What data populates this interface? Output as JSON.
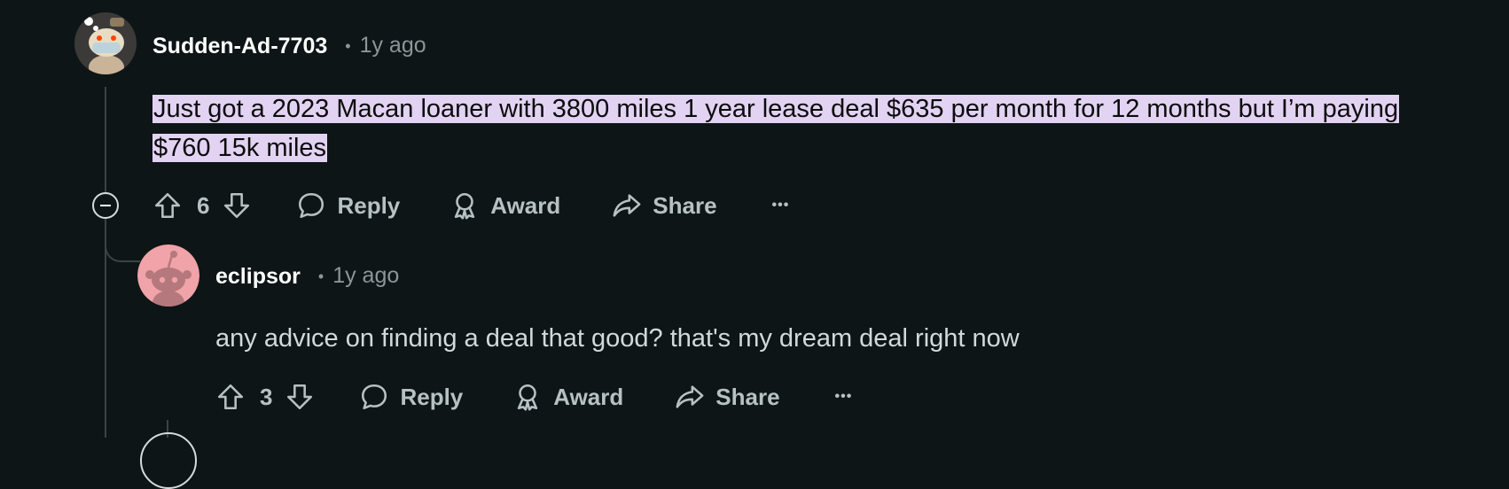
{
  "comments": [
    {
      "username": "Sudden-Ad-7703",
      "time": "1y ago",
      "body": "Just got a 2023 Macan loaner with 3800 miles 1 year lease deal $635 per month for 12 months but I’m paying $760 15k miles",
      "votes": "6",
      "avatar_icon": "snoo-mask-avatar-icon"
    },
    {
      "username": "eclipsor",
      "time": "1y ago",
      "body": "any advice on finding a deal that good? that's my dream deal right now",
      "votes": "3",
      "avatar_icon": "snoo-default-avatar-icon",
      "avatar_color": "#f0a3a8"
    }
  ],
  "actions": {
    "reply": "Reply",
    "award": "Award",
    "share": "Share",
    "more": "•••"
  },
  "colors": {
    "background": "#0e1516",
    "highlight": "#e2d3f3",
    "muted": "#8a9699",
    "action": "#b6c1c4"
  }
}
